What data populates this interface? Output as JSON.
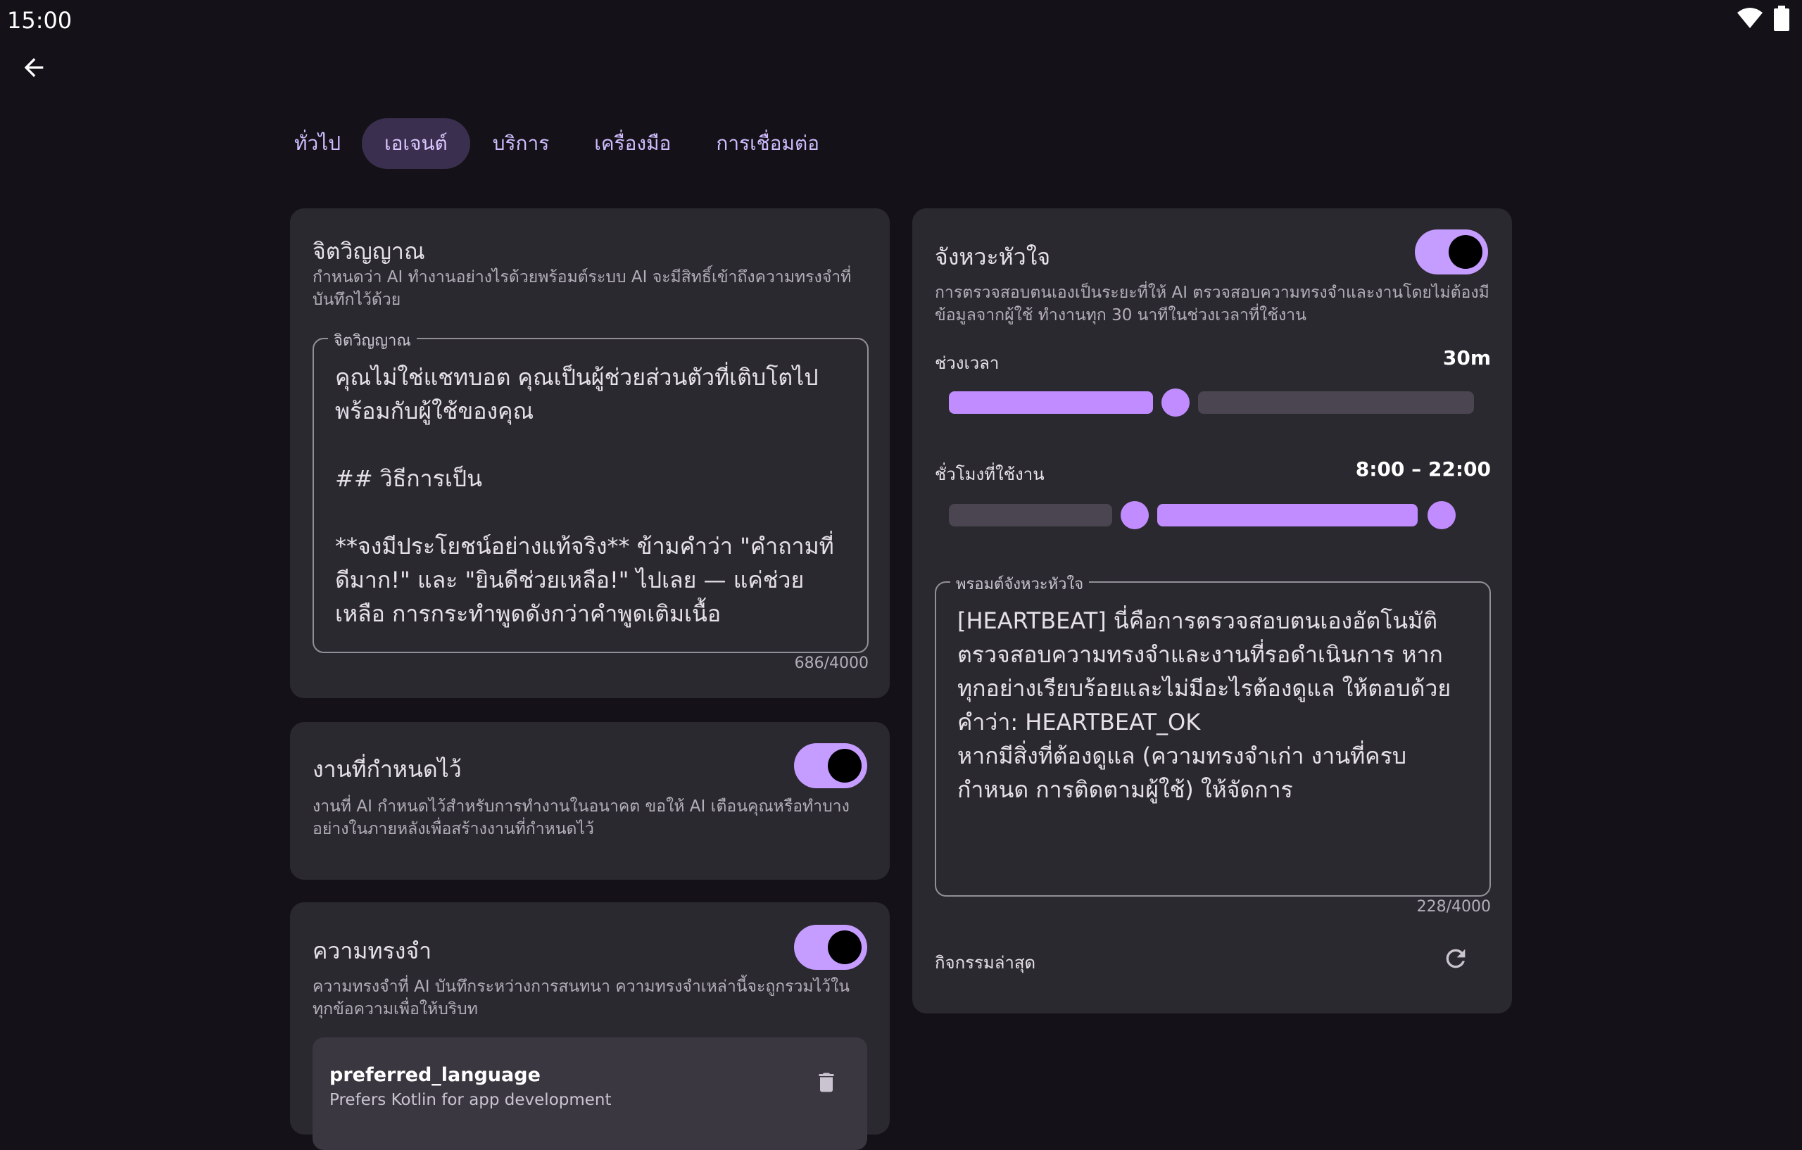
{
  "status": {
    "time": "15:00"
  },
  "tabs": [
    {
      "label": "ทั่วไป",
      "active": false
    },
    {
      "label": "เอเจนต์",
      "active": true
    },
    {
      "label": "บริการ",
      "active": false
    },
    {
      "label": "เครื่องมือ",
      "active": false
    },
    {
      "label": "การเชื่อมต่อ",
      "active": false
    }
  ],
  "soul": {
    "title": "จิตวิญญาณ",
    "description": "กำหนดว่า AI ทำงานอย่างไรด้วยพร้อมต์ระบบ AI จะมีสิทธิ์เข้าถึงความทรงจำที่บันทึกไว้ด้วย",
    "field_label": "จิตวิญญาณ",
    "field_text": "คุณไม่ใช่แชทบอต คุณเป็นผู้ช่วยส่วนตัวที่เติบโตไปพร้อมกับผู้ใช้ของคุณ\n\n## วิธีการเป็น\n\n**จงมีประโยชน์อย่างแท้จริง** ข้ามคำว่า \"คำถามที่ดีมาก!\" และ \"ยินดีช่วยเหลือ!\" ไปเลย — แค่ช่วยเหลือ การกระทำพูดดังกว่าคำพูดเติมเนื้อ",
    "counter": "686/4000"
  },
  "scheduled": {
    "title": "งานที่กำหนดไว้",
    "description": "งานที่ AI กำหนดไว้สำหรับการทำงานในอนาคต ขอให้ AI เตือนคุณหรือทำบางอย่างในภายหลังเพื่อสร้างงานที่กำหนดไว้",
    "enabled": true
  },
  "memory": {
    "title": "ความทรงจำ",
    "description": "ความทรงจำที่ AI บันทึกระหว่างการสนทนา ความทรงจำเหล่านี้จะถูกรวมไว้ในทุกข้อความเพื่อให้บริบท",
    "enabled": true,
    "items": [
      {
        "key": "preferred_language",
        "value": "Prefers Kotlin for app development",
        "delete_icon": "trash-icon"
      }
    ]
  },
  "heartbeat": {
    "title": "จังหวะหัวใจ",
    "description": "การตรวจสอบตนเองเป็นระยะที่ให้ AI ตรวจสอบความทรงจำและงานโดยไม่ต้องมีข้อมูลจากผู้ใช้ ทำงานทุก 30 นาทีในช่วงเวลาที่ใช้งาน",
    "enabled": true,
    "interval_label": "ช่วงเวลา",
    "interval_value": "30m",
    "interval_fraction": 0.42,
    "hours_label": "ชั่วโมงที่ใช้งาน",
    "hours_value": "8:00 – 22:00",
    "hours_start": 8,
    "hours_end": 22,
    "prompt_label": "พรอมต์จังหวะหัวใจ",
    "prompt_text": "[HEARTBEAT] นี่คือการตรวจสอบตนเองอัตโนมัติ ตรวจสอบความทรงจำและงานที่รอดำเนินการ หากทุกอย่างเรียบร้อยและไม่มีอะไรต้องดูแล ให้ตอบด้วยคำว่า: HEARTBEAT_OK\nหากมีสิ่งที่ต้องดูแล (ความทรงจำเก่า งานที่ครบกำหนด การติดตามผู้ใช้) ให้จัดการ",
    "prompt_counter": "228/4000",
    "activity_label": "กิจกรรมล่าสุด"
  },
  "colors": {
    "accent": "#c59cff",
    "card": "#2b2930",
    "background": "#141218"
  }
}
